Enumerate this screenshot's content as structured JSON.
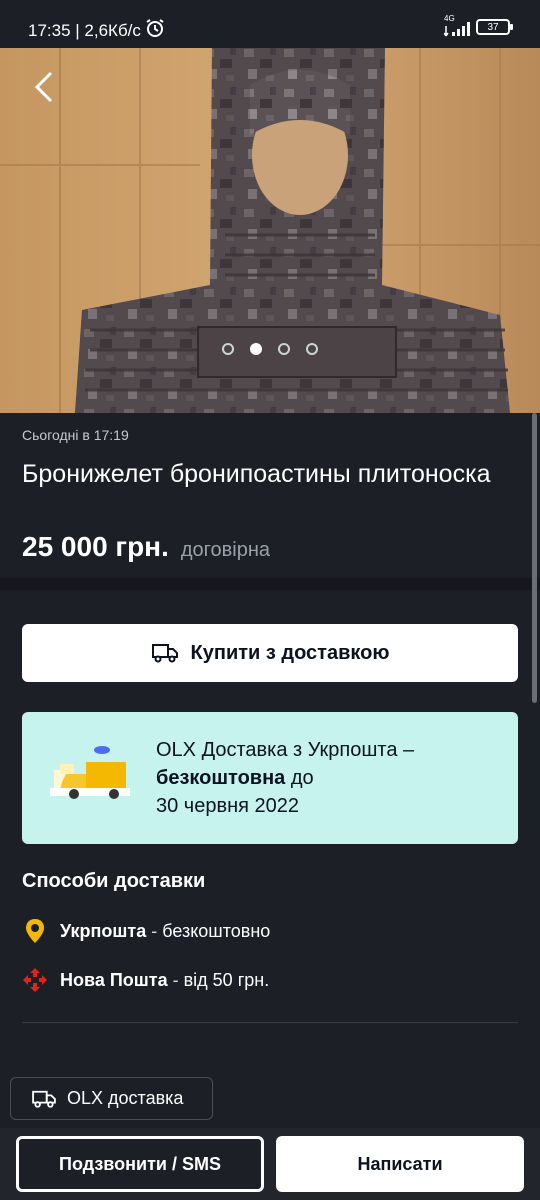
{
  "status_bar": {
    "time_speed": "17:35 | 2,6Кб/с",
    "network": "4G",
    "battery": "37"
  },
  "gallery": {
    "image_desc_icon": "camo-plate-carrier-photo",
    "dots_total": 4,
    "active_index": 1
  },
  "listing": {
    "posted": "Сьогодні в 17:19",
    "title": "Бронижелет бронипоастины плитоноска",
    "price": "25 000 грн.",
    "negotiable": "договірна"
  },
  "buy_button": {
    "label": "Купити з доставкою"
  },
  "promo": {
    "line1": "OLX Доставка з Укрпошта –",
    "bold": "безкоштовна",
    "line2_rest": " до",
    "line3": "30 червня 2022"
  },
  "delivery": {
    "title": "Способи доставки",
    "methods": [
      {
        "name": "Укрпошта",
        "detail": "безкоштовно",
        "icon": "ukrposhta-pin-icon"
      },
      {
        "name": "Нова Пошта",
        "detail": "від 50 грн.",
        "icon": "nova-poshta-icon"
      }
    ]
  },
  "olx_chip": {
    "label": "OLX доставка"
  },
  "bottom": {
    "call_label": "Подзвонити / SMS",
    "write_label": "Написати"
  },
  "colors": {
    "background": "#1d1f27",
    "promo_bg": "#c7f3ef",
    "ukrposhta": "#f5b800",
    "nova_poshta": "#e2231a"
  }
}
